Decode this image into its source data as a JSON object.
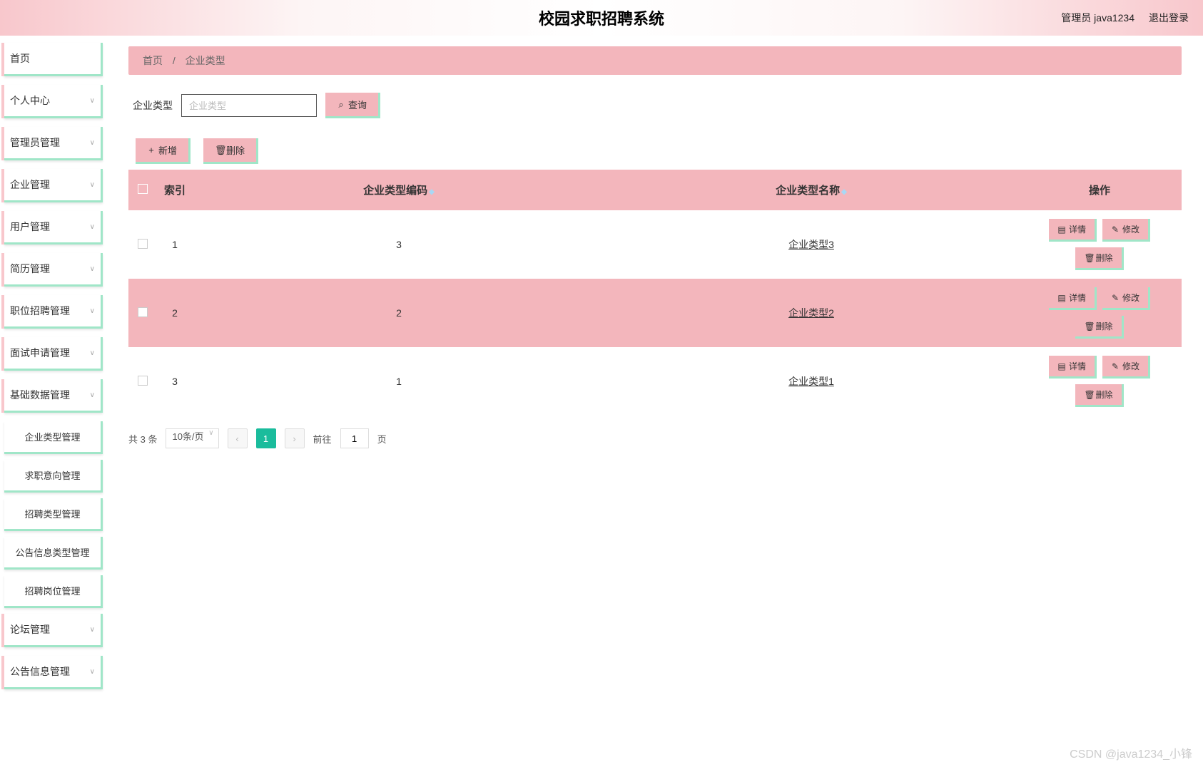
{
  "header": {
    "title": "校园求职招聘系统",
    "admin_label": "管理员 java1234",
    "logout_label": "退出登录"
  },
  "sidebar": {
    "items": [
      {
        "label": "首页",
        "expandable": false
      },
      {
        "label": "个人中心",
        "expandable": true
      },
      {
        "label": "管理员管理",
        "expandable": true
      },
      {
        "label": "企业管理",
        "expandable": true
      },
      {
        "label": "用户管理",
        "expandable": true
      },
      {
        "label": "简历管理",
        "expandable": true
      },
      {
        "label": "职位招聘管理",
        "expandable": true
      },
      {
        "label": "面试申请管理",
        "expandable": true
      },
      {
        "label": "基础数据管理",
        "expandable": true,
        "children": [
          {
            "label": "企业类型管理"
          },
          {
            "label": "求职意向管理"
          },
          {
            "label": "招聘类型管理"
          },
          {
            "label": "公告信息类型管理"
          },
          {
            "label": "招聘岗位管理"
          }
        ]
      },
      {
        "label": "论坛管理",
        "expandable": true
      },
      {
        "label": "公告信息管理",
        "expandable": true
      }
    ]
  },
  "breadcrumb": {
    "home": "首页",
    "sep": "/",
    "current": "企业类型"
  },
  "search": {
    "label": "企业类型",
    "placeholder": "企业类型",
    "query_btn": "查询"
  },
  "actions": {
    "add": "新增",
    "delete": "删除"
  },
  "table": {
    "headers": {
      "index": "索引",
      "code": "企业类型编码",
      "name": "企业类型名称",
      "ops": "操作"
    },
    "row_actions": {
      "detail": "详情",
      "edit": "修改",
      "delete": "删除"
    },
    "rows": [
      {
        "index": "1",
        "code": "3",
        "name": "企业类型3"
      },
      {
        "index": "2",
        "code": "2",
        "name": "企业类型2"
      },
      {
        "index": "3",
        "code": "1",
        "name": "企业类型1"
      }
    ]
  },
  "pagination": {
    "total": "共 3 条",
    "per_page": "10条/页",
    "current": "1",
    "goto_prefix": "前往",
    "goto_value": "1",
    "goto_suffix": "页"
  },
  "watermark": "CSDN @java1234_小锋"
}
